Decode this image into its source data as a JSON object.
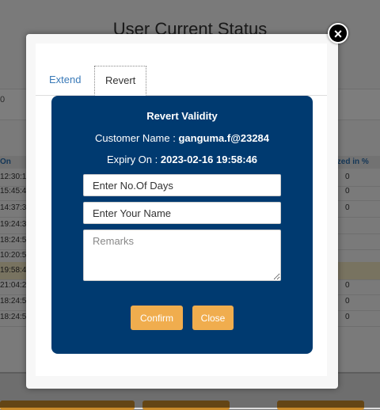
{
  "background": {
    "page_title": "User Current Status",
    "band_text": "0",
    "header_left": "On",
    "header_right": "ized in %",
    "rows": [
      {
        "time": "12:30:1",
        "value": "0"
      },
      {
        "time": "15:45:4",
        "value": "0"
      },
      {
        "time": "14:37:3",
        "value": "0"
      },
      {
        "time": "19:24:3",
        "value": ""
      },
      {
        "time": "18:24:5",
        "value": ""
      },
      {
        "time": "10:20:5",
        "value": ""
      },
      {
        "time": "19:58:4",
        "value": ""
      },
      {
        "time": "21:04:2",
        "value": "0"
      },
      {
        "time": "18:24:5",
        "value": "0"
      },
      {
        "time": "18:24:5",
        "value": "0"
      }
    ]
  },
  "tabs": {
    "extend_label": "Extend",
    "revert_label": "Revert",
    "active": "Revert"
  },
  "revert": {
    "title": "Revert Validity",
    "customer_label": "Customer Name :",
    "customer_value": "ganguma.f@23284",
    "expiry_label": "Expiry On :",
    "expiry_value": "2023-02-16 19:58:46",
    "days_placeholder": "Enter No.Of Days",
    "name_placeholder": "Enter Your Name",
    "remarks_placeholder": "Remarks",
    "confirm_label": "Confirm",
    "close_label": "Close"
  },
  "modal": {
    "close_icon": "close-icon",
    "close_glyph": "×"
  },
  "colors": {
    "panel": "#003a70",
    "button": "#f0ad4e",
    "tab_link": "#3a7ab8"
  }
}
